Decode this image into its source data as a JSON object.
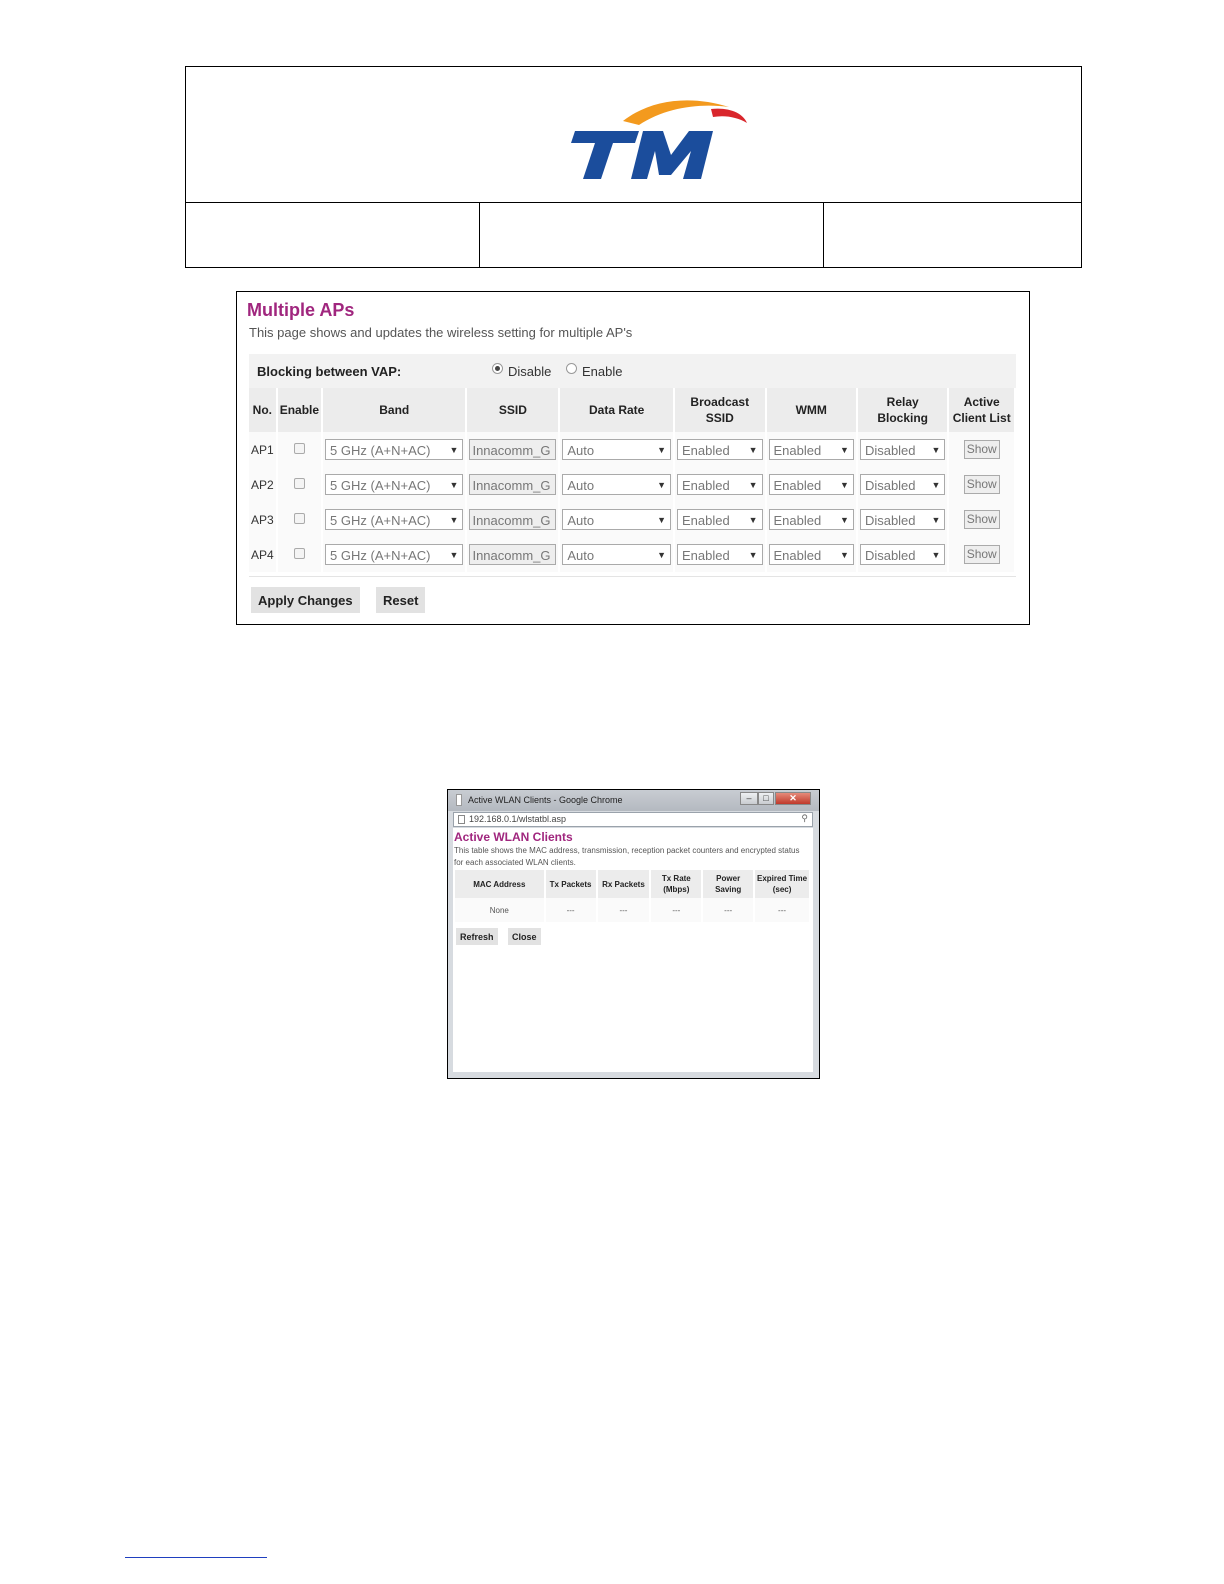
{
  "brand": {
    "logo_text": "TM",
    "colors": {
      "blue": "#1b4d9c",
      "orange": "#f39a1e",
      "red": "#d9262c"
    }
  },
  "header": {
    "cells": [
      "",
      "",
      ""
    ]
  },
  "multiple_aps": {
    "title": "Multiple APs",
    "description": "This page shows and updates the wireless setting for multiple AP's",
    "blocking": {
      "label": "Blocking between VAP:",
      "options": [
        "Disable",
        "Enable"
      ],
      "selected": "Disable"
    },
    "columns": [
      "No.",
      "Enable",
      "Band",
      "SSID",
      "Data Rate",
      "Broadcast SSID",
      "WMM",
      "Relay Blocking",
      "Active Client List"
    ],
    "columns_lines": [
      [
        "No."
      ],
      [
        "Enable"
      ],
      [
        "Band"
      ],
      [
        "SSID"
      ],
      [
        "Data Rate"
      ],
      [
        "Broadcast",
        "SSID"
      ],
      [
        "WMM"
      ],
      [
        "Relay Blocking"
      ],
      [
        "Active",
        "Client List"
      ]
    ],
    "rows": [
      {
        "no": "AP1",
        "enabled": false,
        "band": "5 GHz (A+N+AC)",
        "ssid": "Innacomm_G",
        "data_rate": "Auto",
        "broadcast_ssid": "Enabled",
        "wmm": "Enabled",
        "relay_blocking": "Disabled",
        "client_list": "Show"
      },
      {
        "no": "AP2",
        "enabled": false,
        "band": "5 GHz (A+N+AC)",
        "ssid": "Innacomm_G",
        "data_rate": "Auto",
        "broadcast_ssid": "Enabled",
        "wmm": "Enabled",
        "relay_blocking": "Disabled",
        "client_list": "Show"
      },
      {
        "no": "AP3",
        "enabled": false,
        "band": "5 GHz (A+N+AC)",
        "ssid": "Innacomm_G",
        "data_rate": "Auto",
        "broadcast_ssid": "Enabled",
        "wmm": "Enabled",
        "relay_blocking": "Disabled",
        "client_list": "Show"
      },
      {
        "no": "AP4",
        "enabled": false,
        "band": "5 GHz (A+N+AC)",
        "ssid": "Innacomm_G",
        "data_rate": "Auto",
        "broadcast_ssid": "Enabled",
        "wmm": "Enabled",
        "relay_blocking": "Disabled",
        "client_list": "Show"
      }
    ],
    "buttons": {
      "apply": "Apply Changes",
      "reset": "Reset"
    },
    "title_color": "#a0267e"
  },
  "popup": {
    "window_title": "Active WLAN Clients - Google Chrome",
    "address": "192.168.0.1/wlstatbl.asp",
    "title": "Active WLAN Clients",
    "description": "This table shows the MAC address, transmission, reception packet counters and encrypted status for each associated WLAN clients.",
    "columns_lines": [
      [
        "MAC Address"
      ],
      [
        "Tx Packets"
      ],
      [
        "Rx Packets"
      ],
      [
        "Tx Rate",
        "(Mbps)"
      ],
      [
        "Power",
        "Saving"
      ],
      [
        "Expired Time",
        "(sec)"
      ]
    ],
    "row": [
      "None",
      "---",
      "---",
      "---",
      "---",
      "---"
    ],
    "buttons": {
      "refresh": "Refresh",
      "close": "Close"
    },
    "window_controls": [
      "minimize",
      "maximize",
      "close"
    ]
  }
}
